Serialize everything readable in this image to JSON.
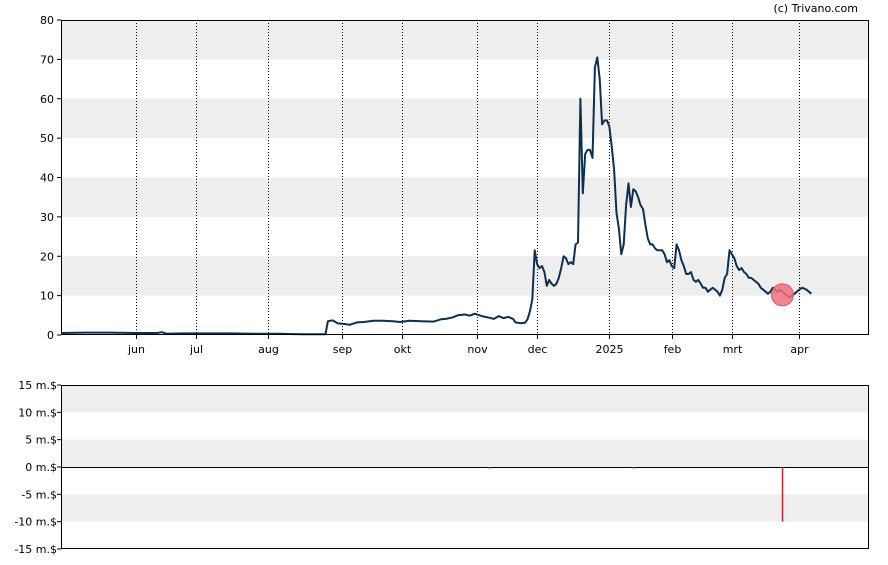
{
  "credit": "(c) Trivano.com",
  "colors": {
    "band": "#eeeeee",
    "line": "#0d3050",
    "marker": "#f07080",
    "bar": "#cc2233"
  },
  "chart_data": [
    {
      "type": "line",
      "y_range": [
        0,
        80
      ],
      "y_ticks": [
        "0",
        "10",
        "20",
        "30",
        "40",
        "50",
        "60",
        "70",
        "80"
      ],
      "x_range": [
        0,
        336
      ],
      "month_ticks": [
        {
          "label": "jun",
          "x": 31
        },
        {
          "label": "jul",
          "x": 56
        },
        {
          "label": "aug",
          "x": 86
        },
        {
          "label": "sep",
          "x": 117
        },
        {
          "label": "okt",
          "x": 142
        },
        {
          "label": "nov",
          "x": 173
        },
        {
          "label": "dec",
          "x": 198
        },
        {
          "label": "2025",
          "x": 228
        },
        {
          "label": "feb",
          "x": 254
        },
        {
          "label": "mrt",
          "x": 279
        },
        {
          "label": "apr",
          "x": 307
        }
      ],
      "series": [
        {
          "points": [
            [
              0,
              0.5
            ],
            [
              10,
              0.6
            ],
            [
              20,
              0.6
            ],
            [
              30,
              0.5
            ],
            [
              40,
              0.5
            ],
            [
              42,
              0.7
            ],
            [
              44,
              0.3
            ],
            [
              50,
              0.4
            ],
            [
              60,
              0.4
            ],
            [
              70,
              0.4
            ],
            [
              80,
              0.3
            ],
            [
              90,
              0.3
            ],
            [
              100,
              0.2
            ],
            [
              108,
              0.2
            ],
            [
              110,
              0.2
            ],
            [
              111,
              3.5
            ],
            [
              113,
              3.7
            ],
            [
              115,
              3.0
            ],
            [
              118,
              2.8
            ],
            [
              120,
              2.6
            ],
            [
              123,
              3.2
            ],
            [
              126,
              3.3
            ],
            [
              130,
              3.6
            ],
            [
              134,
              3.6
            ],
            [
              138,
              3.5
            ],
            [
              141,
              3.3
            ],
            [
              145,
              3.6
            ],
            [
              150,
              3.5
            ],
            [
              155,
              3.4
            ],
            [
              158,
              4.0
            ],
            [
              160,
              4.1
            ],
            [
              163,
              4.5
            ],
            [
              165,
              5.0
            ],
            [
              168,
              5.2
            ],
            [
              170,
              4.9
            ],
            [
              172,
              5.4
            ],
            [
              175,
              4.8
            ],
            [
              178,
              4.4
            ],
            [
              180,
              4.1
            ],
            [
              182,
              4.8
            ],
            [
              184,
              4.3
            ],
            [
              186,
              4.6
            ],
            [
              188,
              4.1
            ],
            [
              189,
              3.2
            ],
            [
              191,
              3.0
            ],
            [
              193,
              3.1
            ],
            [
              194,
              4.0
            ],
            [
              195,
              6.0
            ],
            [
              196,
              9.0
            ],
            [
              197,
              21.5
            ],
            [
              198,
              18.0
            ],
            [
              199,
              17.0
            ],
            [
              200,
              17.5
            ],
            [
              201,
              16.0
            ],
            [
              202,
              12.5
            ],
            [
              203,
              14.0
            ],
            [
              204,
              13.0
            ],
            [
              205,
              12.5
            ],
            [
              206,
              13.0
            ],
            [
              207,
              14.5
            ],
            [
              208,
              17.0
            ],
            [
              209,
              20.0
            ],
            [
              210,
              19.5
            ],
            [
              211,
              18.0
            ],
            [
              212,
              18.5
            ],
            [
              213,
              18.0
            ],
            [
              214,
              23.0
            ],
            [
              215,
              23.5
            ],
            [
              216,
              60.0
            ],
            [
              217,
              36.0
            ],
            [
              218,
              46.0
            ],
            [
              219,
              47.0
            ],
            [
              220,
              47.0
            ],
            [
              221,
              45.0
            ],
            [
              222,
              68.0
            ],
            [
              223,
              70.5
            ],
            [
              224,
              65.0
            ],
            [
              225,
              53.5
            ],
            [
              226,
              54.5
            ],
            [
              227,
              54.5
            ],
            [
              228,
              53.0
            ],
            [
              229,
              48.0
            ],
            [
              230,
              42.0
            ],
            [
              231,
              31.0
            ],
            [
              232,
              27.0
            ],
            [
              233,
              20.5
            ],
            [
              234,
              23.0
            ],
            [
              235,
              33.0
            ],
            [
              236,
              38.5
            ],
            [
              237,
              32.5
            ],
            [
              238,
              37.0
            ],
            [
              239,
              36.5
            ],
            [
              240,
              35.0
            ],
            [
              241,
              33.0
            ],
            [
              242,
              32.0
            ],
            [
              243,
              28.0
            ],
            [
              244,
              24.5
            ],
            [
              245,
              23.0
            ],
            [
              246,
              23.0
            ],
            [
              247,
              22.0
            ],
            [
              248,
              21.5
            ],
            [
              249,
              21.5
            ],
            [
              250,
              21.5
            ],
            [
              251,
              20.5
            ],
            [
              252,
              18.5
            ],
            [
              253,
              19.0
            ],
            [
              254,
              17.5
            ],
            [
              255,
              17.0
            ],
            [
              256,
              23.0
            ],
            [
              257,
              21.5
            ],
            [
              258,
              19.0
            ],
            [
              259,
              17.5
            ],
            [
              260,
              15.5
            ],
            [
              261,
              15.5
            ],
            [
              262,
              16.0
            ],
            [
              263,
              14.0
            ],
            [
              264,
              13.5
            ],
            [
              265,
              14.0
            ],
            [
              266,
              13.0
            ],
            [
              267,
              12.0
            ],
            [
              268,
              12.0
            ],
            [
              269,
              11.0
            ],
            [
              270,
              11.5
            ],
            [
              271,
              12.0
            ],
            [
              272,
              11.5
            ],
            [
              273,
              11.0
            ],
            [
              274,
              10.0
            ],
            [
              275,
              11.5
            ],
            [
              276,
              14.5
            ],
            [
              277,
              15.5
            ],
            [
              278,
              21.5
            ],
            [
              279,
              20.5
            ],
            [
              280,
              19.5
            ],
            [
              281,
              17.5
            ],
            [
              282,
              16.5
            ],
            [
              283,
              17.0
            ],
            [
              284,
              16.0
            ],
            [
              285,
              15.5
            ],
            [
              286,
              14.5
            ],
            [
              287,
              14.5
            ],
            [
              288,
              14.0
            ],
            [
              289,
              13.5
            ],
            [
              290,
              13.0
            ],
            [
              291,
              12.0
            ],
            [
              292,
              11.5
            ],
            [
              293,
              11.0
            ],
            [
              294,
              10.5
            ],
            [
              295,
              11.0
            ],
            [
              296,
              12.0
            ],
            [
              297,
              11.5
            ],
            [
              298,
              11.0
            ],
            [
              299,
              11.5
            ],
            [
              300,
              11.0
            ],
            [
              301,
              10.5
            ],
            [
              302,
              10.0
            ],
            [
              303,
              9.5
            ],
            [
              304,
              10.0
            ],
            [
              305,
              10.5
            ],
            [
              306,
              11.0
            ],
            [
              307,
              11.5
            ],
            [
              308,
              12.0
            ],
            [
              309,
              11.8
            ],
            [
              310,
              11.5
            ],
            [
              311,
              11.0
            ],
            [
              312,
              10.5
            ]
          ]
        }
      ],
      "marker": {
        "x": 300,
        "y": 10.2
      }
    },
    {
      "type": "bar",
      "y_range": [
        -15,
        15
      ],
      "y_ticks": [
        "15 m.$",
        "10 m.$",
        "5 m.$",
        "0 m.$",
        "-5 m.$",
        "-10 m.$",
        "-15 m.$"
      ],
      "x_range": [
        0,
        336
      ],
      "bars": [
        {
          "x": 178,
          "value": -0.3
        },
        {
          "x": 238,
          "value": -0.3
        },
        {
          "x": 300,
          "value": -10.0
        }
      ]
    }
  ]
}
